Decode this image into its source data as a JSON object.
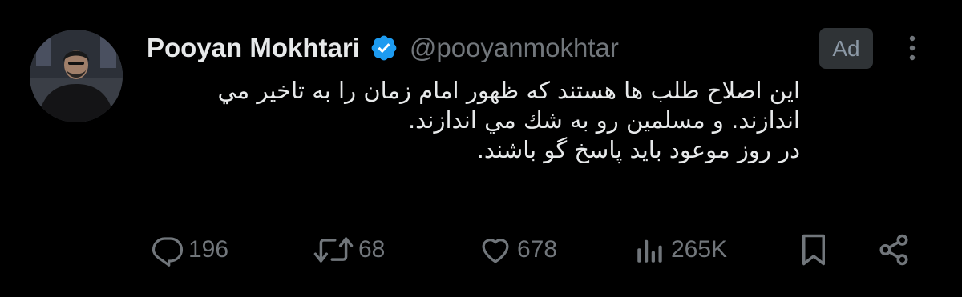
{
  "author": {
    "display_name": "Pooyan Mokhtari",
    "handle": "@pooyanmokhtar",
    "verified": true,
    "verified_color": "#1d9bf0"
  },
  "ad_label": "Ad",
  "tweet": {
    "lines": [
      "این اصلاح طلب ها هستند که ظهور امام زمان را به تاخیر مي اندازند. و مسلمین رو به شك مي اندازند.",
      "در روز موعود باید پاسخ گو باشند."
    ]
  },
  "actions": {
    "replies": "196",
    "retweets": "68",
    "likes": "678",
    "views": "265K"
  },
  "colors": {
    "background": "#000000",
    "text": "#e7e9ea",
    "muted": "#71767b",
    "ad_badge": "#2f3336"
  },
  "icons": [
    "verified-badge-icon",
    "more-options-icon",
    "reply-icon",
    "retweet-icon",
    "like-icon",
    "views-icon",
    "bookmark-icon",
    "share-icon"
  ]
}
